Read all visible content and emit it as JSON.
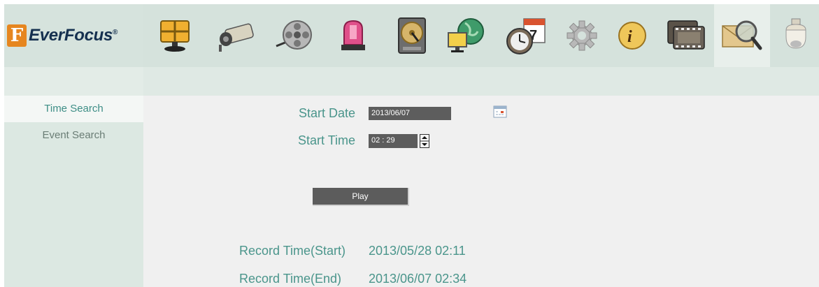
{
  "brand": {
    "name": "EverFocus",
    "mark": "F",
    "trademark": "®"
  },
  "toolbar": {
    "buttons": [
      {
        "name": "live-view-icon"
      },
      {
        "name": "camera-icon"
      },
      {
        "name": "playback-icon"
      },
      {
        "name": "alarm-icon"
      },
      {
        "name": "hdd-icon"
      },
      {
        "name": "network-icon"
      },
      {
        "name": "schedule-icon"
      },
      {
        "name": "settings-icon"
      },
      {
        "name": "info-icon"
      },
      {
        "name": "film-icon"
      },
      {
        "name": "search-icon",
        "active": true
      },
      {
        "name": "ptz-dome-icon"
      }
    ]
  },
  "sidebar": {
    "items": [
      {
        "label": "Time Search",
        "active": true
      },
      {
        "label": "Event Search",
        "active": false
      }
    ]
  },
  "form": {
    "start_date_label": "Start Date",
    "start_date_value": "2013/06/07",
    "start_time_label": "Start Time",
    "start_time_value": "02 : 29",
    "play_label": "Play"
  },
  "record": {
    "start_label": "Record Time(Start)",
    "start_value": "2013/05/28 02:11",
    "end_label": "Record Time(End)",
    "end_value": "2013/06/07 02:34"
  },
  "colors": {
    "accent_text": "#4a958b",
    "header_bg": "#d5e2dc",
    "field_bg": "#5d5d5d"
  }
}
